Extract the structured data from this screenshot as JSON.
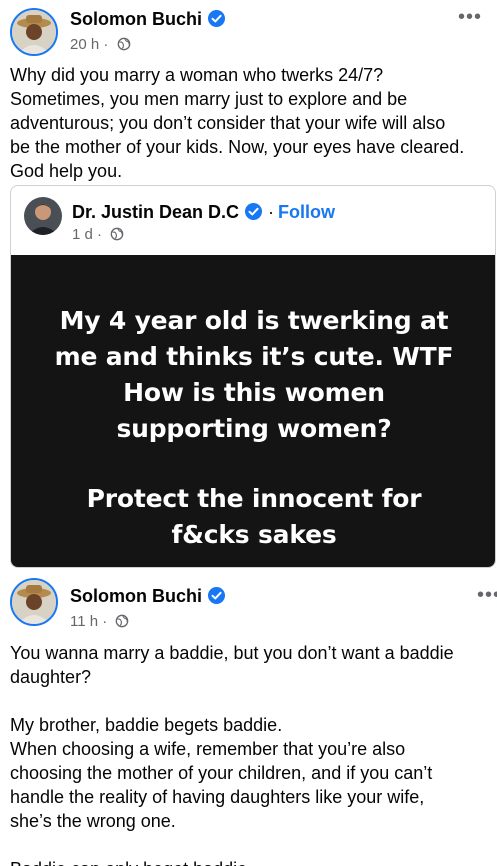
{
  "post1": {
    "author": "Solomon Buchi",
    "time": "20 h",
    "separator": "·",
    "text_lines": [
      "Why did you marry a woman who twerks 24/7?",
      "Sometimes, you men marry just to explore and be",
      "adventurous; you don’t consider that your wife will also",
      "be the mother of your kids. Now, your eyes have cleared.",
      "God help you."
    ]
  },
  "shared": {
    "author": "Dr. Justin Dean D.C",
    "follow_separator": "·",
    "follow_label": "Follow",
    "time": "1 d",
    "separator": "·",
    "image_lines": [
      "My 4 year old is twerking at",
      "me and thinks it’s cute. WTF",
      "How is this women",
      "supporting women?",
      "Protect the innocent for",
      "f&cks sakes"
    ]
  },
  "post2": {
    "author": "Solomon Buchi",
    "time": "11 h",
    "separator": "·",
    "text_lines": [
      "You wanna marry a baddie, but you don’t want a baddie",
      "daughter?",
      "My brother, baddie begets baddie.",
      "When choosing a wife, remember that you’re also",
      "choosing the mother of your children, and if you can’t",
      "handle the reality of having daughters like your wife,",
      "she’s the wrong one.",
      "Baddie can only beget baddie."
    ]
  },
  "icons": {
    "more": "more-horizontal-icon",
    "verified": "verified-badge-icon",
    "audience": "globe-icon"
  },
  "colors": {
    "accent": "#1877f2",
    "secondary_text": "#65676b",
    "image_background": "#141414"
  },
  "more_glyph": "•••"
}
